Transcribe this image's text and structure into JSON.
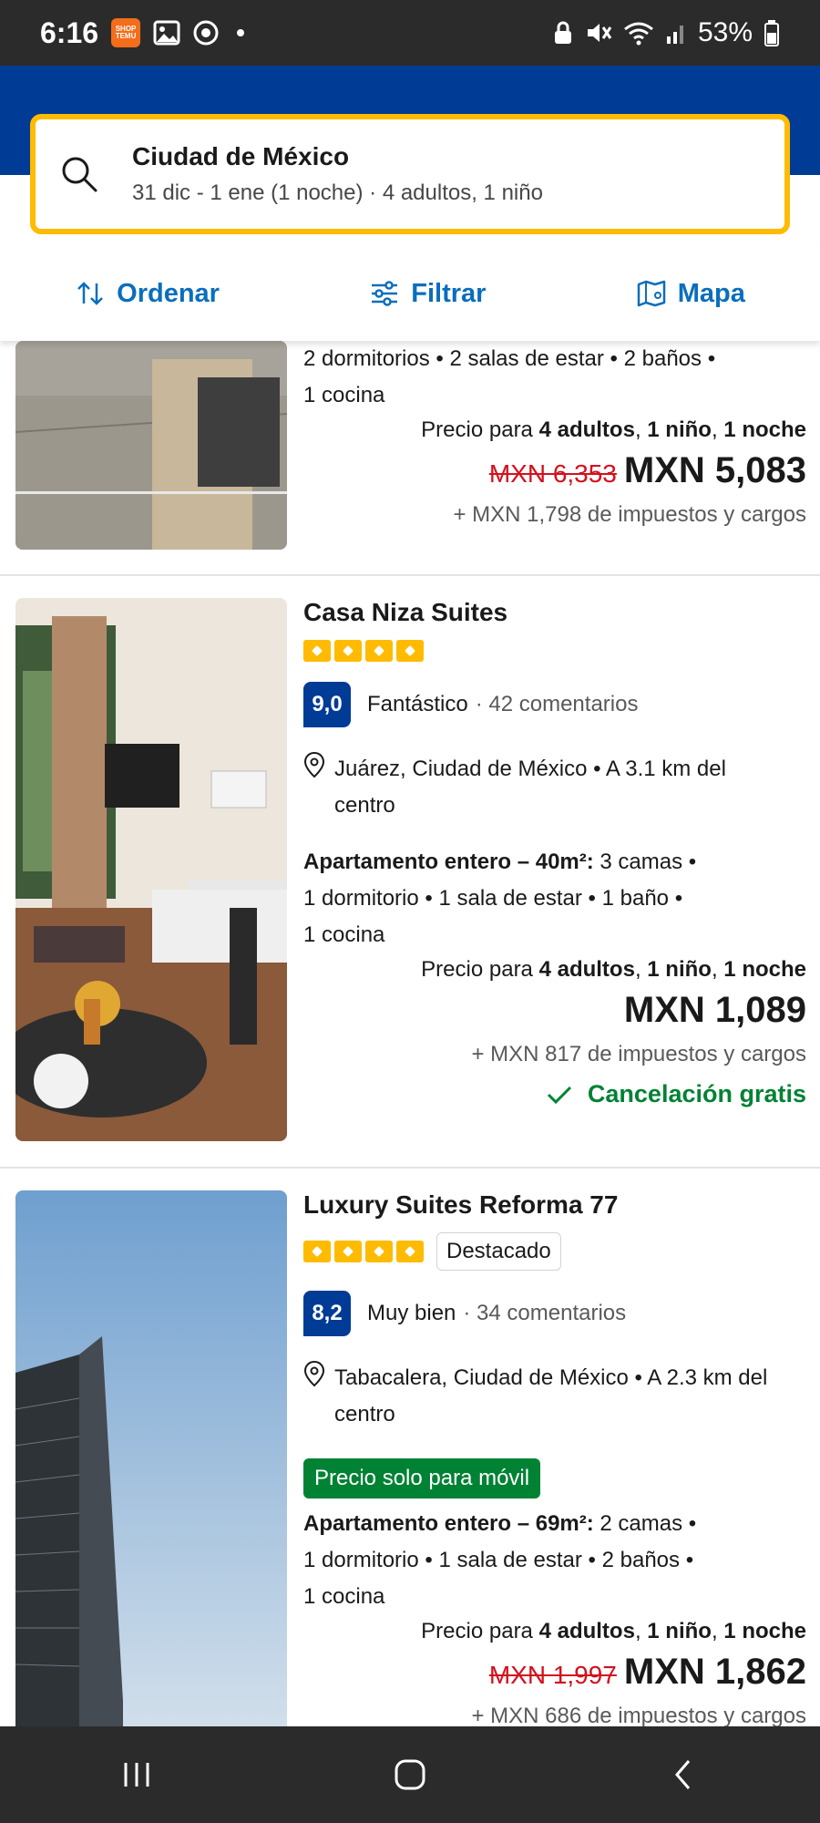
{
  "status_bar": {
    "time": "6:16",
    "temu_label": "SHOP TEMU",
    "battery": "53%"
  },
  "search": {
    "destination": "Ciudad de México",
    "details": "31 dic - 1 ene (1 noche) · 4 adultos, 1 niño"
  },
  "toolbar": {
    "sort_label": "Ordenar",
    "filter_label": "Filtrar",
    "map_label": "Mapa"
  },
  "listings": [
    {
      "partial_unit_line1": "2 dormitorios • 2 salas de estar • 2 baños •",
      "partial_unit_line2": "1 cocina",
      "price_for_prefix": "Precio para ",
      "price_for_bold": "4 adultos",
      "price_for_sep1": ", ",
      "price_for_bold2": "1 niño",
      "price_for_sep2": ", ",
      "price_for_bold3": "1 noche",
      "old_price": "MXN 6,353",
      "price": "MXN 5,083",
      "taxes": "+ MXN 1,798 de impuestos y cargos"
    },
    {
      "name": "Casa Niza Suites",
      "stars": 4,
      "score": "9,0",
      "review_word": "Fantástico",
      "review_count": "· 42 comentarios",
      "location_line1": "Juárez, Ciudad de México • A 3.1 km del",
      "location_line2": "centro",
      "unit_bold": "Apartamento entero – 40m²:",
      "unit_rest": " 3 camas •",
      "unit_line2": "1 dormitorio • 1 sala de estar • 1 baño •",
      "unit_line3": "1 cocina",
      "price_for_prefix": "Precio para ",
      "price_for_bold": "4 adultos",
      "price_for_sep1": ", ",
      "price_for_bold2": "1 niño",
      "price_for_sep2": ", ",
      "price_for_bold3": "1 noche",
      "price": "MXN 1,089",
      "taxes": "+ MXN 817 de impuestos y cargos",
      "free_cancel": "Cancelación gratis"
    },
    {
      "name": "Luxury Suites Reforma 77",
      "stars": 4,
      "featured": "Destacado",
      "score": "8,2",
      "review_word": "Muy bien",
      "review_count": "· 34 comentarios",
      "location_line1": "Tabacalera, Ciudad de México • A 2.3 km del",
      "location_line2": "centro",
      "mobile_badge": "Precio solo para móvil",
      "unit_bold": "Apartamento entero – 69m²:",
      "unit_rest": " 2 camas •",
      "unit_line2": "1 dormitorio • 1 sala de estar • 2 baños •",
      "unit_line3": "1 cocina",
      "price_for_prefix": "Precio para ",
      "price_for_bold": "4 adultos",
      "price_for_sep1": ", ",
      "price_for_bold2": "1 niño",
      "price_for_sep2": ", ",
      "price_for_bold3": "1 noche",
      "old_price": "MXN 1,997",
      "price": "MXN 1,862",
      "taxes": "+ MXN 686 de impuestos y cargos"
    }
  ],
  "colors": {
    "brand_blue": "#003b95",
    "search_border": "#febb02",
    "link_blue": "#0a6ebd",
    "green": "#008234",
    "red": "#d4111e"
  }
}
